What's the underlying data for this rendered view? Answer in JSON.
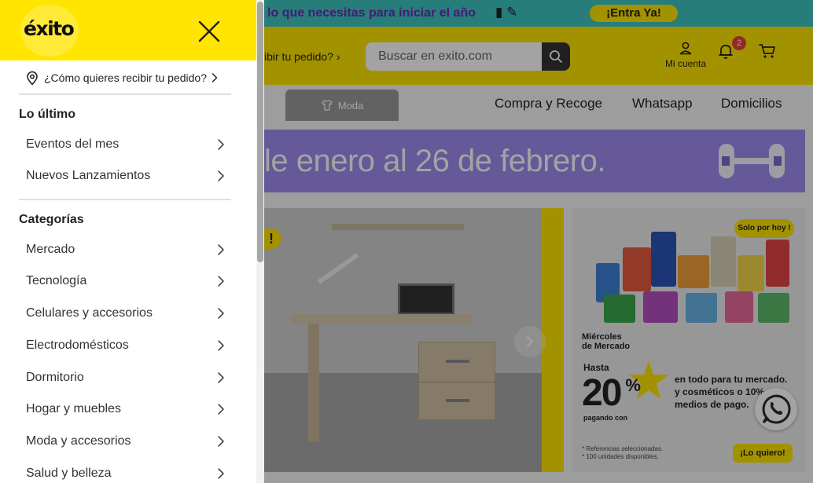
{
  "promo": {
    "text": "lo que necesitas para iniciar el año",
    "cta": "¡Entra Ya!"
  },
  "header": {
    "receive_text": "ibir tu pedido?",
    "search_placeholder": "Buscar en exito.com",
    "account_label": "Mi cuenta",
    "notification_count": "2"
  },
  "nav": {
    "moda": "Moda",
    "links": [
      "Compra y Recoge",
      "Whatsapp",
      "Domicilios"
    ]
  },
  "banner": {
    "text": "le enero al 26 de febrero."
  },
  "hero_left": {
    "chip": "!"
  },
  "hero_right": {
    "badge": "Solo por hoy !",
    "day_line1": "Miércoles",
    "day_line2": "de Mercado",
    "hasta": "Hasta",
    "amount": "20",
    "percent": "%",
    "pagando": "pagando con",
    "desc_line1": "en todo para tu mercado.",
    "desc_line2": "y cosméticos o 10%",
    "desc_line3": "medios de pago.",
    "fine1": "* Referencias seleccionadas.",
    "fine2": "* 100 unidades disponibles.",
    "cta": "¡Lo quiero!"
  },
  "drawer": {
    "logo": "éxito",
    "receive": "¿Cómo quieres recibir tu pedido?",
    "section_latest": "Lo último",
    "latest_items": [
      "Eventos del mes",
      "Nuevos Lanzamientos"
    ],
    "section_categories": "Categorías",
    "categories": [
      "Mercado",
      "Tecnología",
      "Celulares y accesorios",
      "Electrodomésticos",
      "Dormitorio",
      "Hogar y muebles",
      "Moda y accesorios",
      "Salud y belleza"
    ]
  },
  "colors": {
    "brand_yellow": "#ffe500",
    "accent_purple": "#6a2bb6",
    "banner_purple": "#9f8cef",
    "badge_red": "#e4443a"
  },
  "icons": [
    "close-icon",
    "location-pin-icon",
    "chevron-right-icon",
    "search-icon",
    "user-icon",
    "bell-icon",
    "cart-icon",
    "whatsapp-icon",
    "shirt-icon",
    "dumbbell-icon"
  ]
}
